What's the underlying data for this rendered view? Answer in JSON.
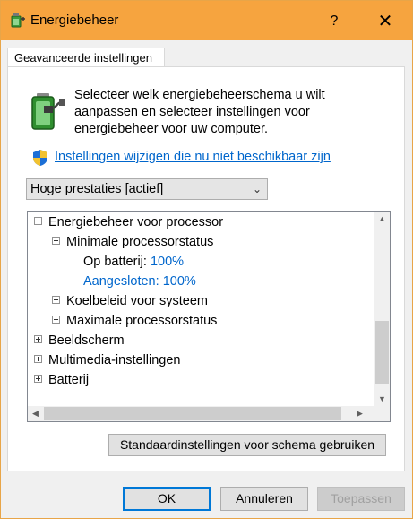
{
  "window": {
    "title": "Energiebeheer",
    "help_glyph": "?",
    "close_glyph": "✕"
  },
  "tabs": [
    {
      "label": "Geavanceerde instellingen"
    }
  ],
  "intro_text": "Selecteer welk energiebeheerschema u wilt aanpassen en selecteer instellingen voor energiebeheer voor uw computer.",
  "change_link": "Instellingen wijzigen die nu niet beschikbaar zijn",
  "plan_select": {
    "value": "Hoge prestaties [actief]"
  },
  "tree": {
    "processor": "Energiebeheer voor processor",
    "min_state": "Minimale processorstatus",
    "on_battery_label": "Op batterij:",
    "on_battery_value": "100%",
    "plugged_in_label": "Aangesloten:",
    "plugged_in_value": "100%",
    "cooling": "Koelbeleid voor systeem",
    "max_state": "Maximale processorstatus",
    "display": "Beeldscherm",
    "multimedia": "Multimedia-instellingen",
    "battery": "Batterij"
  },
  "buttons": {
    "restore_defaults": "Standaardinstellingen voor schema gebruiken",
    "ok": "OK",
    "cancel": "Annuleren",
    "apply": "Toepassen"
  },
  "colors": {
    "titlebar": "#f6a43f",
    "link": "#0066cc",
    "focus": "#0078d7"
  }
}
